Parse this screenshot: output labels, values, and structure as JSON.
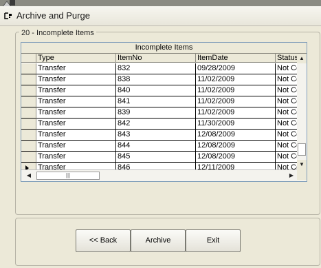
{
  "window": {
    "title": "Archive and Purge"
  },
  "group": {
    "label": "20 - Incomplete Items"
  },
  "grid": {
    "caption": "Incomplete Items",
    "columns": [
      "Type",
      "ItemNo",
      "ItemDate",
      "Status"
    ],
    "rows": [
      [
        "Transfer",
        "832",
        "09/28/2009",
        "Not Co"
      ],
      [
        "Transfer",
        "838",
        "11/02/2009",
        "Not Co"
      ],
      [
        "Transfer",
        "840",
        "11/02/2009",
        "Not Co"
      ],
      [
        "Transfer",
        "841",
        "11/02/2009",
        "Not Co"
      ],
      [
        "Transfer",
        "839",
        "11/02/2009",
        "Not Co"
      ],
      [
        "Transfer",
        "842",
        "11/30/2009",
        "Not Co"
      ],
      [
        "Transfer",
        "843",
        "12/08/2009",
        "Not Co"
      ],
      [
        "Transfer",
        "844",
        "12/08/2009",
        "Not Co"
      ],
      [
        "Transfer",
        "845",
        "12/08/2009",
        "Not Co"
      ],
      [
        "Transfer",
        "846",
        "12/11/2009",
        "Not Co"
      ]
    ],
    "current_row": 9
  },
  "buttons": {
    "back": "<< Back",
    "archive": "Archive",
    "exit": "Exit"
  }
}
